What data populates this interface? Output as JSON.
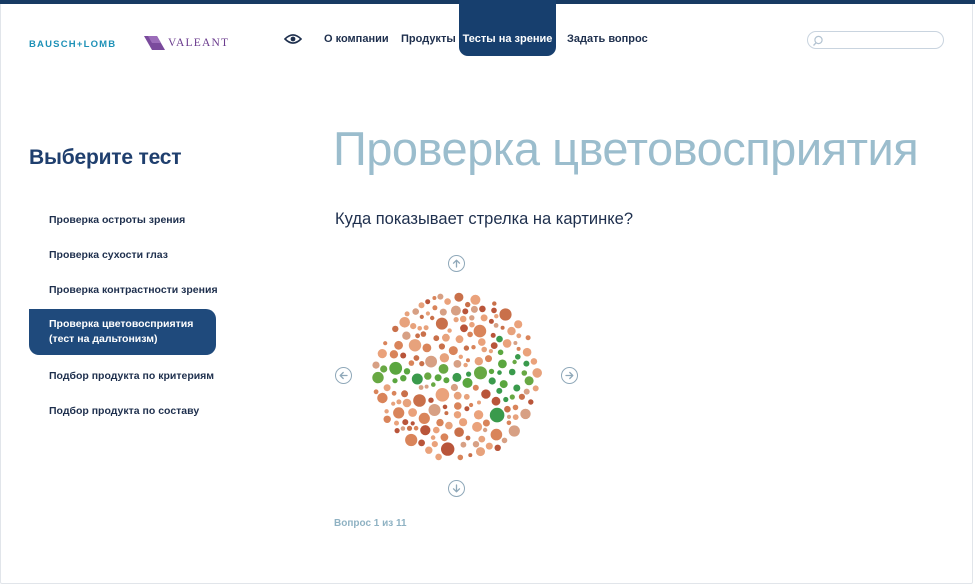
{
  "brand": {
    "bausch_lomb": "BAUSCH+LOMB",
    "valeant": "VALEANT"
  },
  "nav": {
    "items": [
      {
        "label": "О компании"
      },
      {
        "label": "Продукты"
      },
      {
        "label": "Тесты на зрение"
      },
      {
        "label": "Задать вопрос"
      }
    ],
    "active_index": 2,
    "icons": [
      "eye-icon"
    ]
  },
  "search": {
    "value": "",
    "placeholder": "",
    "icon": "search-icon"
  },
  "sidebar": {
    "title": "Выберите тест",
    "items": [
      {
        "label": "Проверка остроты зрения"
      },
      {
        "label": "Проверка сухости глаз"
      },
      {
        "label": "Проверка контрастности зрения"
      },
      {
        "label": "Проверка цветовосприятия (тест на дальтонизм)"
      },
      {
        "label": "Подбор продукта по критериям"
      },
      {
        "label": "Подбор продукта по составу"
      }
    ],
    "active_index": 3
  },
  "main": {
    "title": "Проверка цветовосприятия",
    "question": "Куда показывает стрелка на картинке?",
    "answer_buttons": [
      {
        "direction": "up",
        "icon": "arrow-up-icon"
      },
      {
        "direction": "left",
        "icon": "arrow-left-icon"
      },
      {
        "direction": "right",
        "icon": "arrow-right-icon"
      },
      {
        "direction": "down",
        "icon": "arrow-down-icon"
      }
    ],
    "progress": "Вопрос 1 из 11"
  },
  "colors": {
    "navy": "#173f6e",
    "title_light_blue": "#9bbdcd",
    "plate_background": [
      "#d9845a",
      "#e7a27c",
      "#c9704a",
      "#b9553a",
      "#eaa27b",
      "#d7a084"
    ],
    "plate_figure": [
      "#3a9a4c",
      "#68a843",
      "#5aa63f"
    ]
  }
}
